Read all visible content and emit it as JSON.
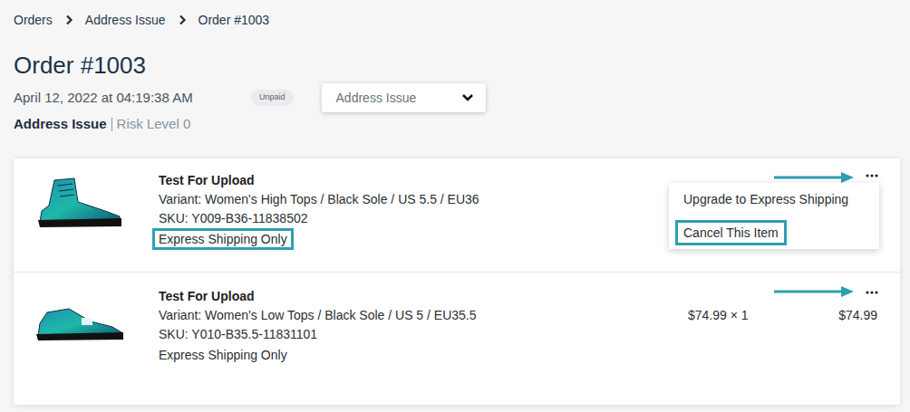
{
  "breadcrumb": [
    {
      "label": "Orders"
    },
    {
      "label": "Address Issue"
    },
    {
      "label": "Order #1003"
    }
  ],
  "order": {
    "title": "Order #1003",
    "date": "April 12, 2022 at 04:19:38 AM",
    "payment_status": "Unpaid",
    "status_select": "Address Issue",
    "status": "Address Issue",
    "risk": "Risk Level 0"
  },
  "items": [
    {
      "kind": "high-top",
      "title": "Test For Upload",
      "variant": "Variant: Women's High Tops / Black Sole / US 5.5 / EU36",
      "sku": "SKU: Y009-B36-11838502",
      "shipping": "Express Shipping Only",
      "shipping_highlighted": true,
      "menu_open": true,
      "menu_arrow": true
    },
    {
      "kind": "low-top",
      "title": "Test For Upload",
      "variant": "Variant: Women's Low Tops / Black Sole / US 5 / EU35.5",
      "sku": "SKU: Y010-B35.5-11831101",
      "shipping": "Express Shipping Only",
      "shipping_highlighted": false,
      "menu_open": false,
      "menu_arrow": false,
      "price": "$74.99 × 1",
      "total": "$74.99"
    }
  ],
  "item_menu": {
    "options": [
      {
        "label": "Upgrade to Express Shipping",
        "highlighted": false
      },
      {
        "label": "Cancel This Item",
        "highlighted": true
      }
    ]
  }
}
